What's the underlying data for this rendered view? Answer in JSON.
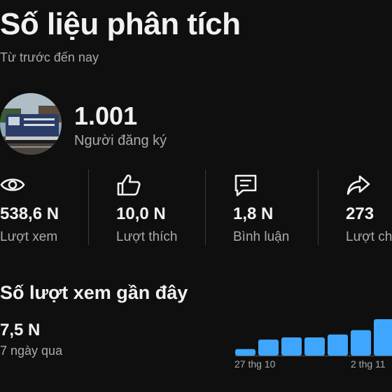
{
  "header": {
    "title": "Số liệu phân tích",
    "subtitle": "Từ trước đến nay"
  },
  "channel": {
    "subscribers": "1.001",
    "subscribers_label": "Người đăng ký"
  },
  "stats": [
    {
      "icon": "eye-icon",
      "value": "538,6 N",
      "label": "Lượt xem"
    },
    {
      "icon": "thumbs-up-icon",
      "value": "10,0 N",
      "label": "Lượt thích"
    },
    {
      "icon": "comment-icon",
      "value": "1,8 N",
      "label": "Bình luận"
    },
    {
      "icon": "share-icon",
      "value": "273",
      "label": "Lượt chia sẻ"
    }
  ],
  "recent": {
    "title": "Số lượt xem gần đây",
    "value": "7,5 N",
    "period": "7 ngày qua"
  },
  "chart_data": {
    "type": "bar",
    "x_labels": [
      "27 thg 10",
      "2 thg 11"
    ],
    "values": [
      0.18,
      0.44,
      0.5,
      0.5,
      0.58,
      0.7,
      1.0
    ],
    "color": "#3ea6ff"
  },
  "colors": {
    "background": "#0f0f0f",
    "text": "#f1f1f1",
    "muted": "#aaaaaa",
    "accent": "#3ea6ff"
  }
}
